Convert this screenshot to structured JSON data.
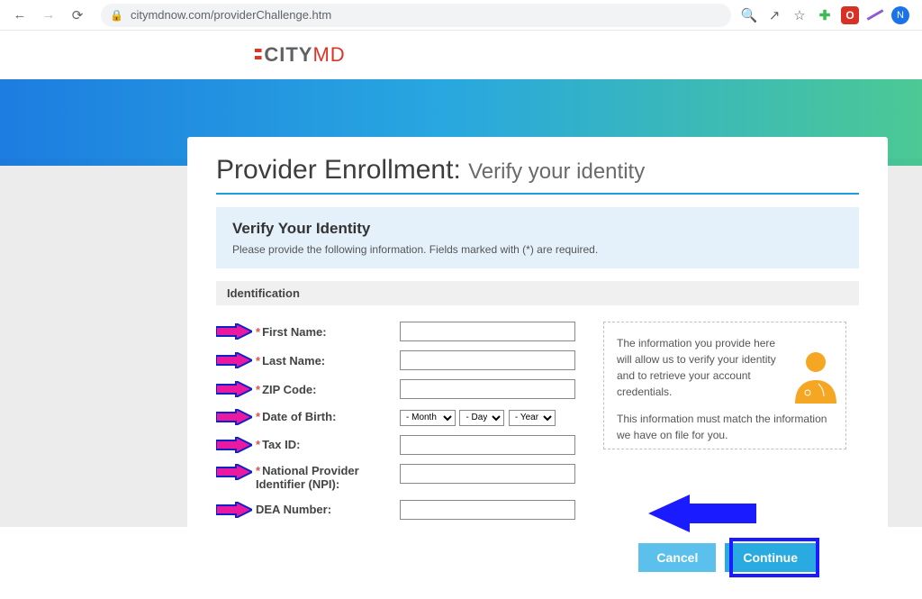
{
  "browser": {
    "url": "citymdnow.com/providerChallenge.htm",
    "ext_blue_letter": "N"
  },
  "logo": {
    "text1": "CITY",
    "text2": "MD"
  },
  "title": {
    "main": "Provider Enrollment: ",
    "sub": "Verify your identity"
  },
  "verify": {
    "heading": "Verify Your Identity",
    "desc": "Please provide the following information. Fields marked with (*) are required."
  },
  "section_label": "Identification",
  "fields": {
    "first_name": {
      "label": "First Name:"
    },
    "last_name": {
      "label": "Last Name:"
    },
    "zip": {
      "label": "ZIP Code:"
    },
    "dob": {
      "label": "Date of Birth:",
      "month": "- Month -",
      "day": "- Day -",
      "year": "- Year -"
    },
    "tax_id": {
      "label": "Tax ID:"
    },
    "npi": {
      "label": "National Provider Identifier (NPI):"
    },
    "dea": {
      "label": "DEA Number:"
    }
  },
  "info_panel": {
    "p1": "The information you provide here will allow us to verify your identity and to retrieve your account credentials.",
    "p2": "This information must match the information we have on file for you."
  },
  "buttons": {
    "cancel": "Cancel",
    "continue": "Continue"
  }
}
